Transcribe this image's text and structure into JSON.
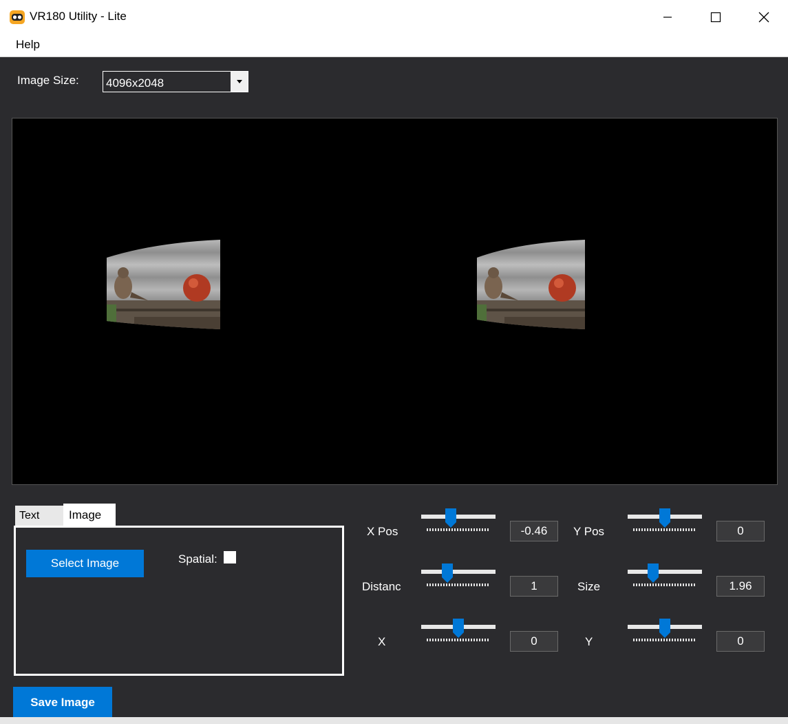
{
  "window": {
    "title": "VR180 Utility - Lite",
    "icon": "vr-headset-icon",
    "controls": [
      "minimize-icon",
      "maximize-icon",
      "close-icon"
    ]
  },
  "menu": {
    "items": [
      "Help"
    ]
  },
  "image_size": {
    "label": "Image Size:",
    "selected": "4096x2048"
  },
  "tabs": [
    {
      "label": "Text",
      "active": false
    },
    {
      "label": "Image",
      "active": true
    }
  ],
  "image_panel": {
    "select_button": "Select Image",
    "spatial_label": "Spatial:",
    "spatial_checked": false
  },
  "controls": {
    "x_pos": {
      "label": "X Pos",
      "value": "-0.46"
    },
    "y_pos": {
      "label": "Y Pos",
      "value": "0"
    },
    "distance": {
      "label": "Distanc",
      "value": "1"
    },
    "size": {
      "label": "Size",
      "value": "1.96"
    },
    "x": {
      "label": "X",
      "value": "0"
    },
    "y": {
      "label": "Y",
      "value": "0"
    }
  },
  "save_button": "Save Image",
  "colors": {
    "accent": "#0078d7",
    "background": "#2b2b2e",
    "preview_bg": "#000000"
  }
}
